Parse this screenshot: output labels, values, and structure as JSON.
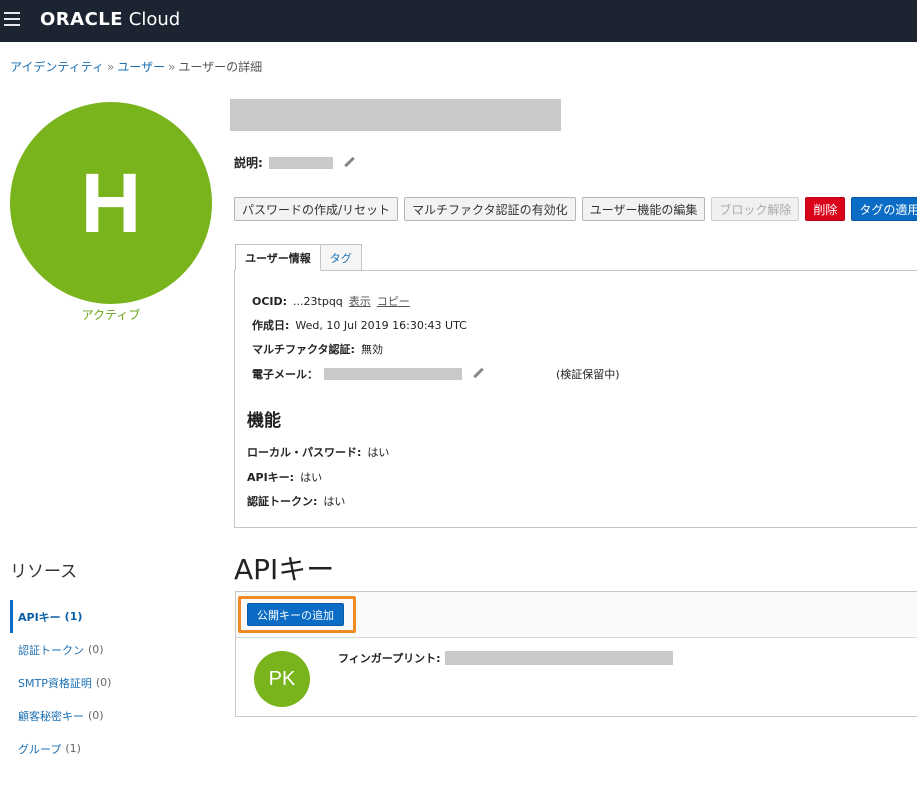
{
  "header": {
    "brand_bold": "ORACLE",
    "brand_light": " Cloud"
  },
  "breadcrumb": {
    "items": [
      "アイデンティティ",
      "ユーザー",
      "ユーザーの詳細"
    ],
    "separator": "»"
  },
  "user": {
    "avatar_letter": "H",
    "status": "アクティブ",
    "description_label": "説明:"
  },
  "actions": {
    "create_reset_password": "パスワードの作成/リセット",
    "enable_mfa": "マルチファクタ認証の有効化",
    "edit_user_capabilities": "ユーザー機能の編集",
    "unblock": "ブロック解除",
    "delete": "削除",
    "apply_tags": "タグの適用"
  },
  "tabs": {
    "user_info": "ユーザー情報",
    "tags": "タグ"
  },
  "info": {
    "ocid_label": "OCID:",
    "ocid_value": "...23tpqq",
    "show_link": "表示",
    "copy_link": "コピー",
    "created_label": "作成日:",
    "created_value": "Wed, 10 Jul 2019 16:30:43 UTC",
    "mfa_label": "マルチファクタ認証:",
    "mfa_value": "無効",
    "email_label": "電子メール：",
    "email_status": "(検証保留中)"
  },
  "capabilities": {
    "title": "機能",
    "local_password_label": "ローカル・パスワード:",
    "local_password_value": "はい",
    "api_keys_label": "APIキー:",
    "api_keys_value": "はい",
    "auth_tokens_label": "認証トークン:",
    "auth_tokens_value": "はい"
  },
  "resources": {
    "title": "リソース",
    "items": [
      {
        "label": "APIキー",
        "count": "(1)"
      },
      {
        "label": "認証トークン",
        "count": "(0)"
      },
      {
        "label": "SMTP資格証明",
        "count": "(0)"
      },
      {
        "label": "顧客秘密キー",
        "count": "(0)"
      },
      {
        "label": "グループ",
        "count": "(1)"
      }
    ]
  },
  "api_keys": {
    "title": "APIキー",
    "add_button": "公開キーの追加",
    "key_avatar": "PK",
    "fingerprint_label": "フィンガープリント:"
  },
  "colors": {
    "topbar": "#1d2431",
    "avatar_green": "#7ab41d",
    "primary_blue": "#0a6cc4",
    "danger_red": "#d9041a",
    "highlight_orange": "#f08a24"
  }
}
